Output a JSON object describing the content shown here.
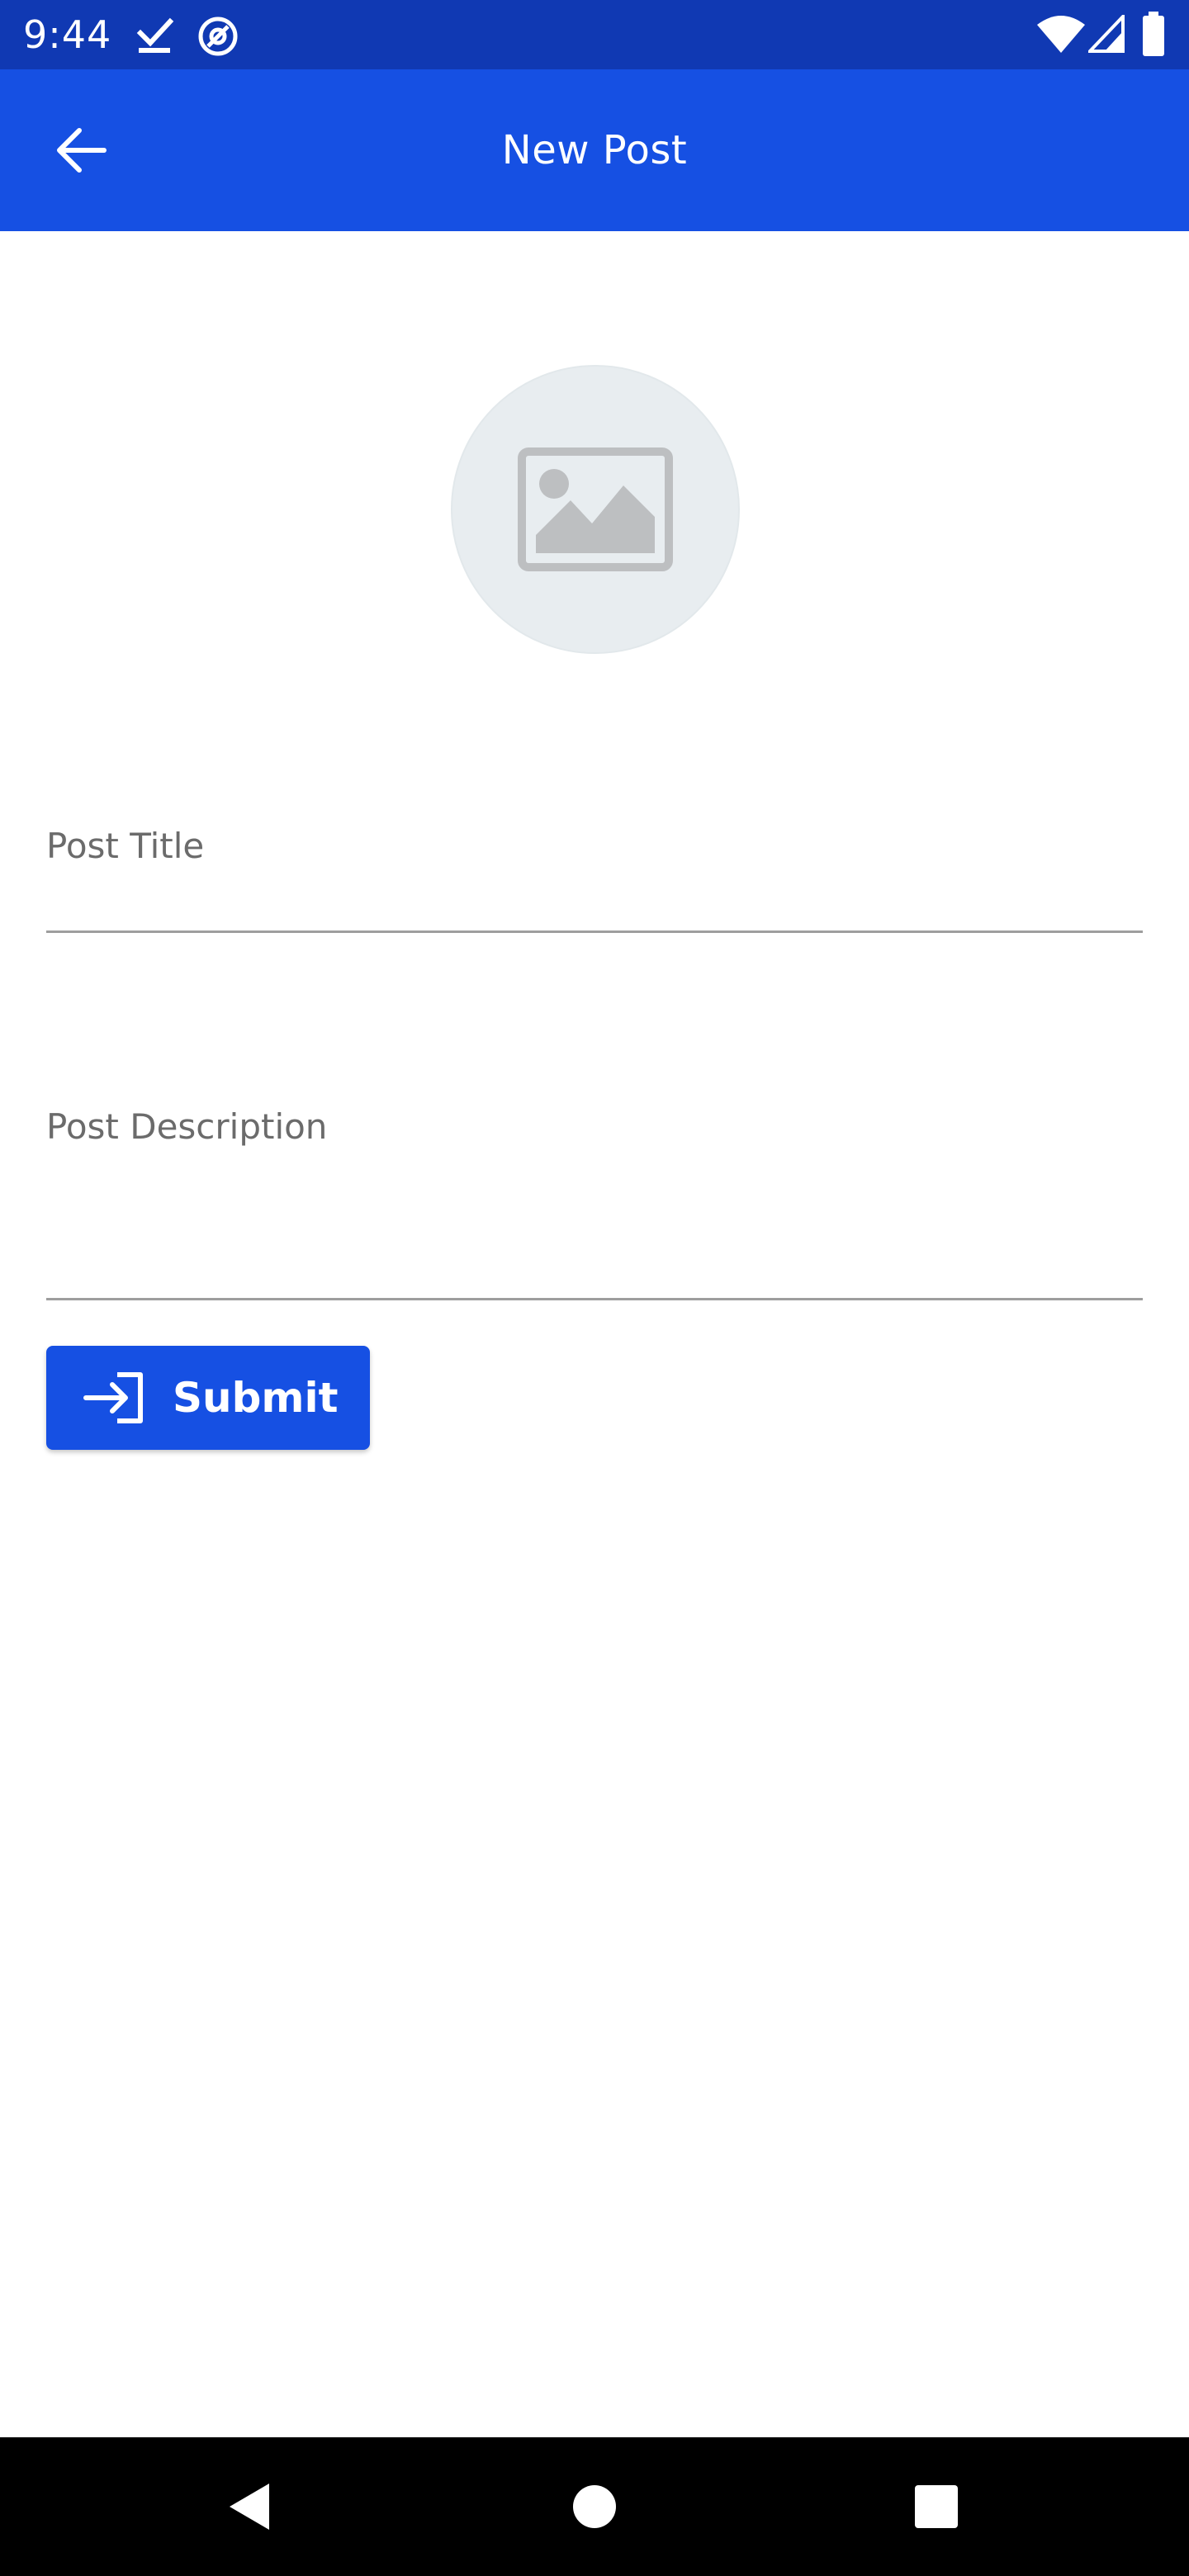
{
  "status_bar": {
    "time": "9:44",
    "icons": [
      "checkmark-icon",
      "at-sign-icon",
      "wifi-icon",
      "cell-signal-icon",
      "battery-icon"
    ]
  },
  "app_bar": {
    "title": "New Post",
    "back_icon": "arrow-left-icon"
  },
  "image_picker": {
    "icon": "image-placeholder-icon"
  },
  "form": {
    "title_field": {
      "label": "Post Title",
      "value": ""
    },
    "description_field": {
      "label": "Post Description",
      "value": ""
    }
  },
  "submit_button": {
    "label": "Submit",
    "icon": "login-arrow-icon"
  },
  "nav_bar": {
    "icons": [
      "nav-back-icon",
      "nav-home-icon",
      "nav-recents-icon"
    ]
  },
  "colors": {
    "status_bar": "#1039b3",
    "primary": "#1650e3",
    "placeholder_bg": "#e8edf0",
    "placeholder_icon": "#bdbfc1",
    "label_text": "#6b6b6b",
    "underline": "#9e9e9e"
  }
}
